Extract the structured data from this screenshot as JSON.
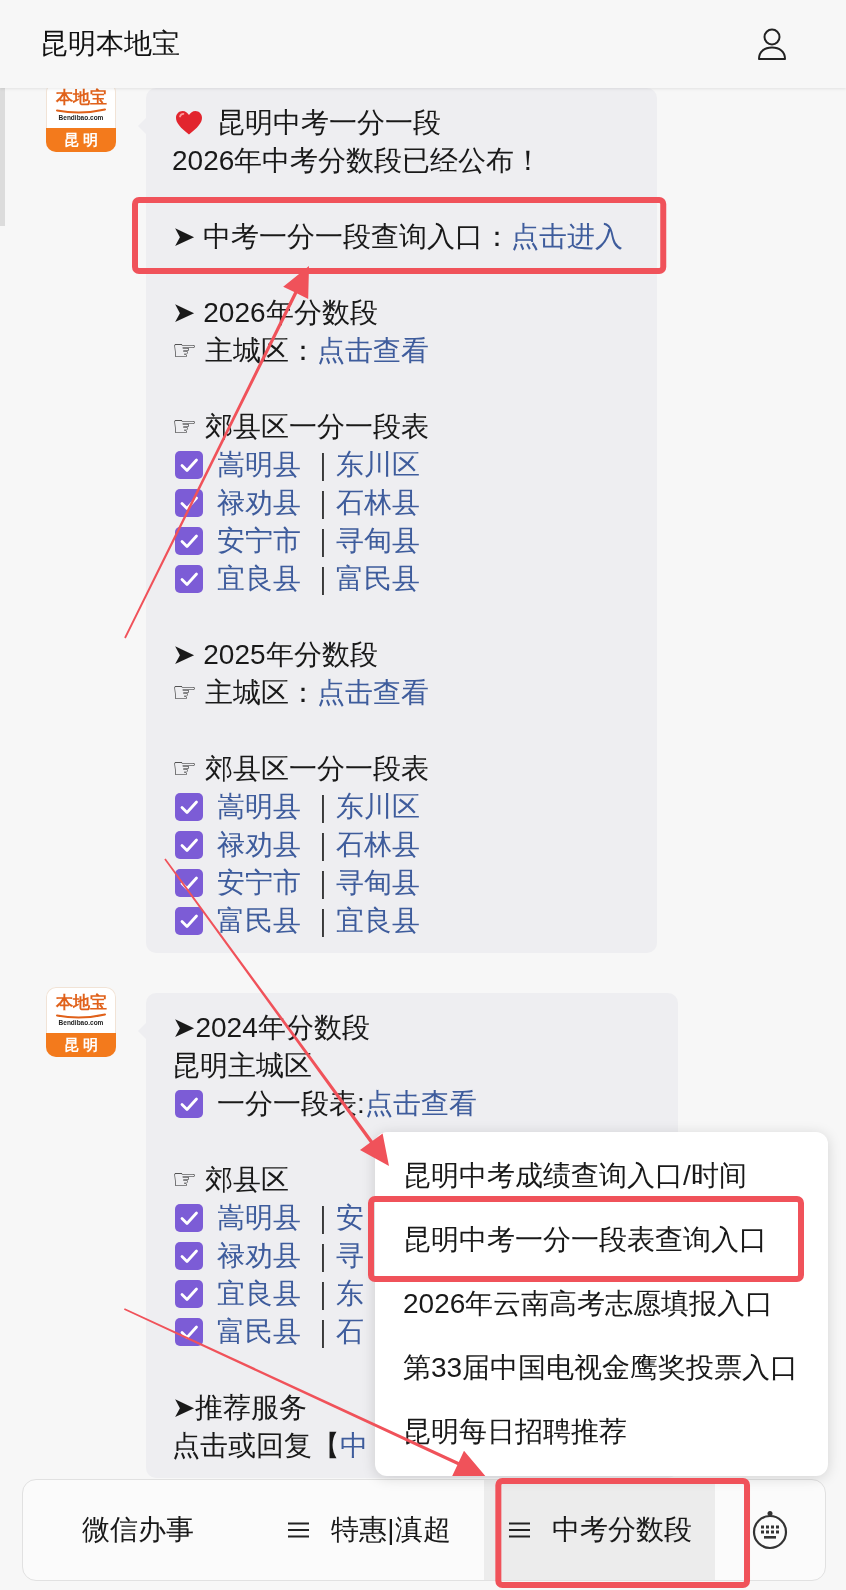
{
  "header": {
    "title": "昆明本地宝"
  },
  "messages": [
    {
      "avatar": {
        "brand": "本地宝",
        "site": "Bendibao.com",
        "city": "昆明"
      },
      "sections": [
        {
          "highlighted": false,
          "lines": [
            {
              "kind": "heart",
              "parts": [
                {
                  "text": "昆明中考一分一段",
                  "link": false
                }
              ]
            },
            {
              "kind": "text",
              "parts": [
                {
                  "text": "2026年中考分数段已经公布！",
                  "link": false
                }
              ]
            }
          ]
        },
        {
          "highlighted": true,
          "lines": [
            {
              "kind": "text",
              "parts": [
                {
                  "text": "➤ 中考一分一段查询入口：",
                  "link": false
                },
                {
                  "text": "点击进入",
                  "link": true
                }
              ]
            }
          ]
        },
        {
          "highlighted": false,
          "lines": [
            {
              "kind": "text",
              "parts": [
                {
                  "text": "➤ 2026年分数段",
                  "link": false
                }
              ]
            },
            {
              "kind": "text",
              "parts": [
                {
                  "text": "☞ 主城区：",
                  "link": false
                },
                {
                  "text": "点击查看",
                  "link": true
                }
              ]
            }
          ]
        },
        {
          "highlighted": false,
          "lines": [
            {
              "kind": "text",
              "parts": [
                {
                  "text": "☞ 郊县区一分一段表",
                  "link": false
                }
              ]
            },
            {
              "kind": "check",
              "parts": [
                {
                  "text": "嵩明县",
                  "link": true
                },
                {
                  "text": "｜",
                  "link": false
                },
                {
                  "text": "东川区",
                  "link": true
                }
              ]
            },
            {
              "kind": "check",
              "parts": [
                {
                  "text": "禄劝县",
                  "link": true
                },
                {
                  "text": "｜",
                  "link": false
                },
                {
                  "text": "石林县",
                  "link": true
                }
              ]
            },
            {
              "kind": "check",
              "parts": [
                {
                  "text": "安宁市",
                  "link": true
                },
                {
                  "text": "｜",
                  "link": false
                },
                {
                  "text": "寻甸县",
                  "link": true
                }
              ]
            },
            {
              "kind": "check",
              "parts": [
                {
                  "text": "宜良县",
                  "link": true
                },
                {
                  "text": "｜",
                  "link": false
                },
                {
                  "text": "富民县",
                  "link": true
                }
              ]
            }
          ]
        },
        {
          "highlighted": false,
          "lines": [
            {
              "kind": "text",
              "parts": [
                {
                  "text": "➤ 2025年分数段",
                  "link": false
                }
              ]
            },
            {
              "kind": "text",
              "parts": [
                {
                  "text": "☞ 主城区：",
                  "link": false
                },
                {
                  "text": "点击查看",
                  "link": true
                }
              ]
            }
          ]
        },
        {
          "highlighted": false,
          "lines": [
            {
              "kind": "text",
              "parts": [
                {
                  "text": "☞ 郊县区一分一段表",
                  "link": false
                }
              ]
            },
            {
              "kind": "check",
              "parts": [
                {
                  "text": "嵩明县",
                  "link": true
                },
                {
                  "text": "｜",
                  "link": false
                },
                {
                  "text": "东川区",
                  "link": true
                }
              ]
            },
            {
              "kind": "check",
              "parts": [
                {
                  "text": "禄劝县",
                  "link": true
                },
                {
                  "text": "｜",
                  "link": false
                },
                {
                  "text": "石林县",
                  "link": true
                }
              ]
            },
            {
              "kind": "check",
              "parts": [
                {
                  "text": "安宁市",
                  "link": true
                },
                {
                  "text": "｜",
                  "link": false
                },
                {
                  "text": "寻甸县",
                  "link": true
                }
              ]
            },
            {
              "kind": "check",
              "parts": [
                {
                  "text": "富民县",
                  "link": true
                },
                {
                  "text": "｜",
                  "link": false
                },
                {
                  "text": "宜良县",
                  "link": true
                }
              ]
            }
          ]
        }
      ]
    },
    {
      "avatar": {
        "brand": "本地宝",
        "site": "Bendibao.com",
        "city": "昆明"
      },
      "sections": [
        {
          "highlighted": false,
          "lines": [
            {
              "kind": "text",
              "parts": [
                {
                  "text": "➤2024年分数段",
                  "link": false
                }
              ]
            },
            {
              "kind": "text",
              "parts": [
                {
                  "text": "昆明主城区",
                  "link": false
                }
              ]
            },
            {
              "kind": "check",
              "parts": [
                {
                  "text": "一分一段表:",
                  "link": false
                },
                {
                  "text": "点击查看",
                  "link": true
                }
              ]
            }
          ]
        },
        {
          "highlighted": false,
          "lines": [
            {
              "kind": "text",
              "parts": [
                {
                  "text": "☞ 郊县区",
                  "link": false
                }
              ]
            },
            {
              "kind": "check",
              "parts": [
                {
                  "text": "嵩明县",
                  "link": true
                },
                {
                  "text": "｜",
                  "link": false
                },
                {
                  "text": "安",
                  "link": true
                }
              ]
            },
            {
              "kind": "check",
              "parts": [
                {
                  "text": "禄劝县",
                  "link": true
                },
                {
                  "text": "｜",
                  "link": false
                },
                {
                  "text": "寻",
                  "link": true
                }
              ]
            },
            {
              "kind": "check",
              "parts": [
                {
                  "text": "宜良县",
                  "link": true
                },
                {
                  "text": "｜",
                  "link": false
                },
                {
                  "text": "东",
                  "link": true
                }
              ]
            },
            {
              "kind": "check",
              "parts": [
                {
                  "text": "富民县",
                  "link": true
                },
                {
                  "text": "｜",
                  "link": false
                },
                {
                  "text": "石",
                  "link": true
                }
              ]
            }
          ]
        },
        {
          "highlighted": false,
          "lines": [
            {
              "kind": "text",
              "parts": [
                {
                  "text": "➤推荐服务",
                  "link": false
                }
              ]
            },
            {
              "kind": "text",
              "parts": [
                {
                  "text": "点击或回复【",
                  "link": false
                },
                {
                  "text": "中",
                  "link": true
                }
              ]
            }
          ]
        }
      ]
    }
  ],
  "menu": {
    "items": [
      {
        "label": "昆明中考成绩查询入口/时间",
        "highlighted": false
      },
      {
        "label": "昆明中考一分一段表查询入口",
        "highlighted": true
      },
      {
        "label": "2026年云南高考志愿填报入口",
        "highlighted": false
      },
      {
        "label": "第33届中国电视金鹰奖投票入口",
        "highlighted": false
      },
      {
        "label": "昆明每日招聘推荐",
        "highlighted": false
      }
    ]
  },
  "bottom_bar": {
    "tabs": [
      {
        "label": "微信办事",
        "submenu": false,
        "selected": false,
        "highlighted": false
      },
      {
        "label": "特惠|滇超",
        "submenu": true,
        "selected": false,
        "highlighted": false
      },
      {
        "label": "中考分数段",
        "submenu": true,
        "selected": true,
        "highlighted": true
      }
    ]
  }
}
